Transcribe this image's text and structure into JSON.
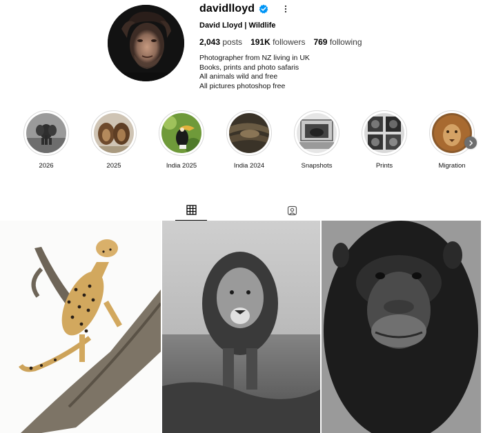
{
  "profile": {
    "username": "davidlloyd",
    "full_name": "David Lloyd | Wildlife",
    "verified_icon": "verified-badge-icon",
    "more_icon": "more-dots-icon",
    "stats": {
      "posts_count": "2,043",
      "posts_label": "posts",
      "followers_count": "191K",
      "followers_label": "followers",
      "following_count": "769",
      "following_label": "following"
    },
    "bio": [
      "Photographer from NZ living in UK",
      "Books, prints and photo safaris",
      "All animals wild and free",
      "All pictures photoshop free"
    ]
  },
  "highlights": [
    {
      "label": "2026",
      "icon": "elephant-thumbnail"
    },
    {
      "label": "2025",
      "icon": "lions-thumbnail"
    },
    {
      "label": "India 2025",
      "icon": "hornbill-thumbnail"
    },
    {
      "label": "India 2024",
      "icon": "india-2024-thumbnail"
    },
    {
      "label": "Snapshots",
      "icon": "snapshots-thumbnail"
    },
    {
      "label": "Prints",
      "icon": "prints-thumbnail"
    },
    {
      "label": "Migration",
      "icon": "lion-face-thumbnail"
    }
  ],
  "tabs": [
    {
      "name": "posts-grid",
      "icon": "grid-icon",
      "active": true
    },
    {
      "name": "tagged",
      "icon": "tagged-person-icon",
      "active": false
    }
  ],
  "posts": [
    {
      "subject": "cheetah-on-tree"
    },
    {
      "subject": "lion-walking-bw"
    },
    {
      "subject": "chimpanzee-portrait-bw"
    }
  ],
  "colors": {
    "verified_blue": "#0095f6",
    "text_primary": "#000000",
    "ring_border": "#d8d8d8"
  }
}
